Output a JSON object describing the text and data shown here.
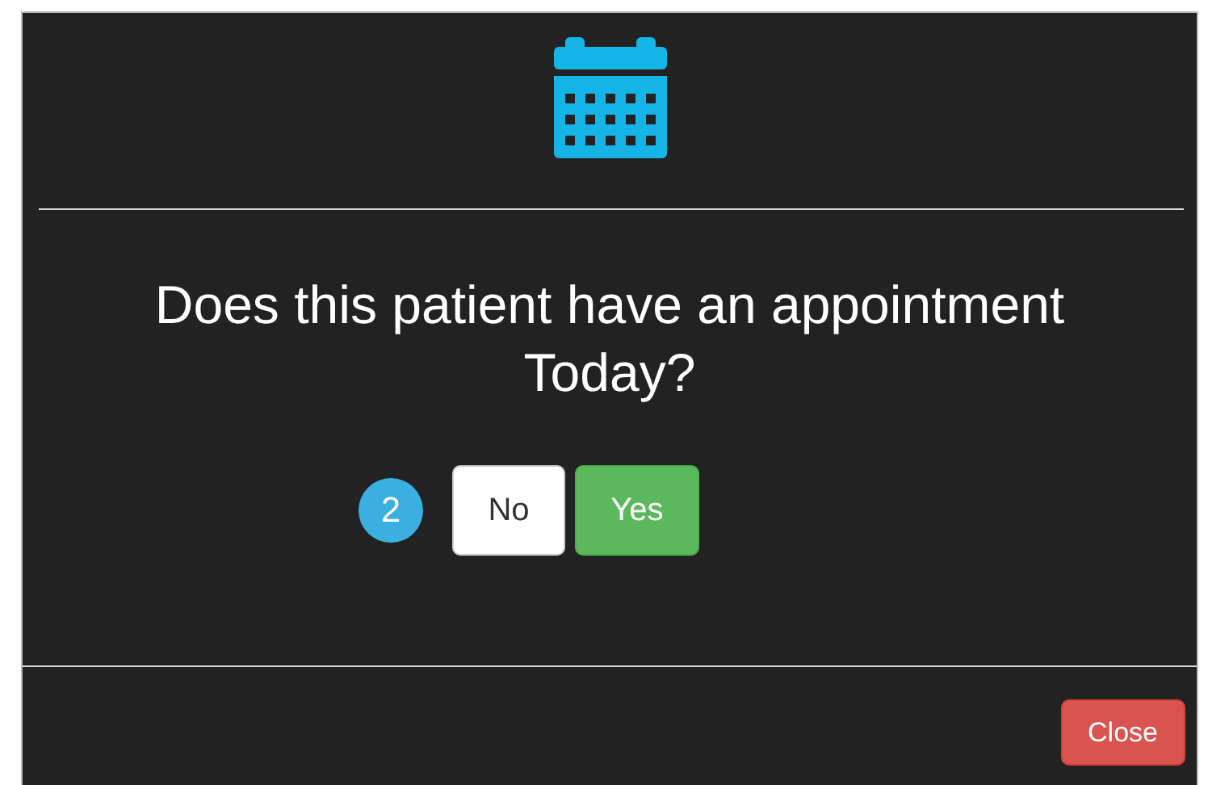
{
  "question": "Does this patient have an appointment Today?",
  "step_badge": "2",
  "answers": [
    {
      "label": "No",
      "kind": "default"
    },
    {
      "label": "Yes",
      "kind": "success"
    }
  ],
  "footer_buttons": [
    {
      "label": "Close",
      "kind": "danger"
    }
  ]
}
